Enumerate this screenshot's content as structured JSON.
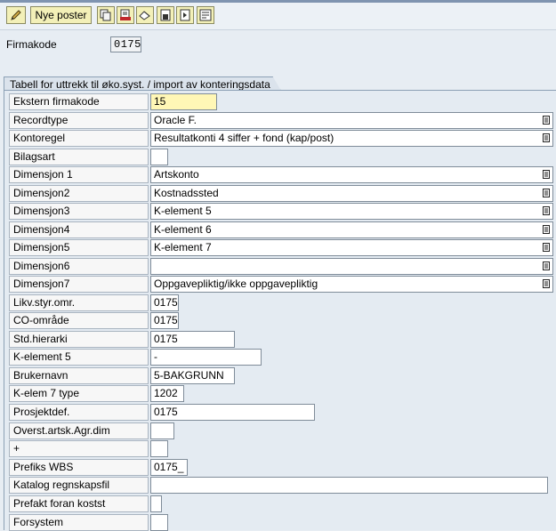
{
  "toolbar": {
    "new_entries_label": "Nye poster",
    "icons": [
      "pencil-icon",
      "copy-icon",
      "delete-icon",
      "undo-icon",
      "save-icon",
      "export-icon",
      "list-icon"
    ]
  },
  "header": {
    "firmakode_label": "Firmakode",
    "firmakode_value": "0175"
  },
  "tab": {
    "title": "Tabell for uttrekk til øko.syst. / import av konteringsdata"
  },
  "fields": [
    {
      "label": "Ekstern firmakode",
      "value": "15"
    },
    {
      "label": "Recordtype",
      "value": "Oracle F."
    },
    {
      "label": "Kontoregel",
      "value": "Resultatkonti 4 siffer + fond (kap/post)"
    },
    {
      "label": "Bilagsart",
      "value": ""
    },
    {
      "label": "Dimensjon 1",
      "value": "Artskonto"
    },
    {
      "label": "Dimensjon2",
      "value": "Kostnadssted"
    },
    {
      "label": "Dimensjon3",
      "value": "K-element 5"
    },
    {
      "label": "Dimensjon4",
      "value": "K-element 6"
    },
    {
      "label": "Dimensjon5",
      "value": "K-element 7"
    },
    {
      "label": "Dimensjon6",
      "value": ""
    },
    {
      "label": "Dimensjon7",
      "value": "Oppgavepliktig/ikke oppgavepliktig"
    },
    {
      "label": "Likv.styr.omr.",
      "value": "0175"
    },
    {
      "label": "CO-område",
      "value": "0175"
    },
    {
      "label": "Std.hierarki",
      "value": "0175"
    },
    {
      "label": "K-element 5",
      "value": "-"
    },
    {
      "label": "Brukernavn",
      "value": "5-BAKGRUNN"
    },
    {
      "label": "K-elem 7 type",
      "value": "1202"
    },
    {
      "label": "Prosjektdef.",
      "value": "0175"
    },
    {
      "label": "Overst.artsk.Agr.dim",
      "value": ""
    },
    {
      "label": "+",
      "value": ""
    },
    {
      "label": "Prefiks WBS",
      "value": "0175_"
    },
    {
      "label": "Katalog regnskapsfil",
      "value": ""
    },
    {
      "label": "Prefakt foran kostst",
      "value": ""
    },
    {
      "label": "Forsystem",
      "value": ""
    }
  ]
}
